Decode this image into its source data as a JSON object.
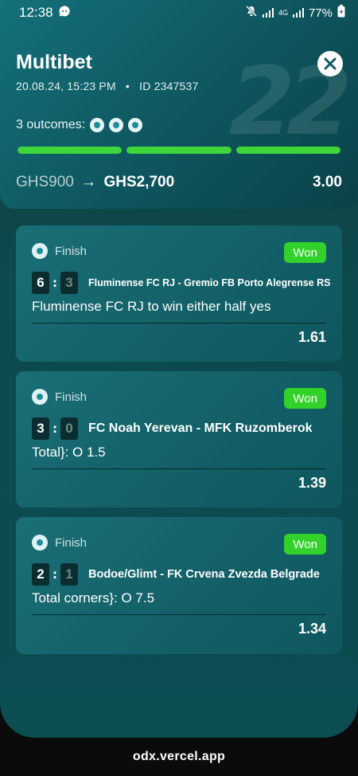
{
  "status_bar": {
    "time": "12:38",
    "network": "4G",
    "battery": "77%"
  },
  "bet": {
    "title": "Multibet",
    "datetime": "20.08.24, 15:23 PM",
    "separator": "•",
    "id_label": "ID 2347537",
    "watermark": "22",
    "outcomes_label": "3 outcomes:",
    "stake": "GHS900",
    "arrow": "→",
    "payout": "GHS2,700",
    "total_odds": "3.00",
    "progress": [
      1.0,
      1.0,
      1.0
    ]
  },
  "colors": {
    "accent_green": "#33d22b",
    "progress_green": "#3fd63a",
    "card_bg": "#14656d",
    "page_bg": "#0d4a4e"
  },
  "selections": [
    {
      "status": "Finish",
      "result": "Won",
      "home_score": "6",
      "away_score": "3",
      "teams": "Fluminense FC RJ - Gremio FB Porto Alegrense RS",
      "market": "Fluminense FC RJ to win either half yes",
      "odds": "1.61"
    },
    {
      "status": "Finish",
      "result": "Won",
      "home_score": "3",
      "away_score": "0",
      "teams": "FC Noah Yerevan - MFK Ruzomberok",
      "market": "Total}: O 1.5",
      "odds": "1.39"
    },
    {
      "status": "Finish",
      "result": "Won",
      "home_score": "2",
      "away_score": "1",
      "teams": "Bodoe/Glimt - FK Crvena Zvezda Belgrade",
      "market": "Total corners}: O 7.5",
      "odds": "1.34"
    }
  ],
  "footer": {
    "url": "odx.vercel.app"
  }
}
